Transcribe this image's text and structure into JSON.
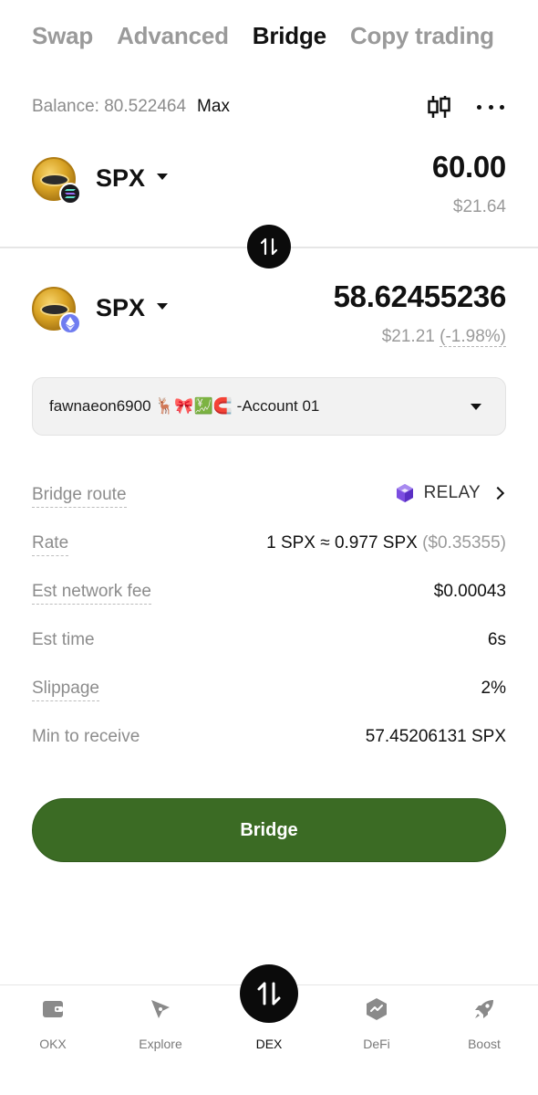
{
  "tabs": [
    {
      "label": "Swap",
      "active": false
    },
    {
      "label": "Advanced",
      "active": false
    },
    {
      "label": "Bridge",
      "active": true
    },
    {
      "label": "Copy trading",
      "active": false
    }
  ],
  "balance": {
    "label": "Balance: 80.522464",
    "max_label": "Max"
  },
  "from": {
    "symbol": "SPX",
    "chain_icon": "solana-icon",
    "amount": "60.00",
    "fiat": "$21.64"
  },
  "to": {
    "symbol": "SPX",
    "chain_icon": "ethereum-icon",
    "amount": "58.62455236",
    "fiat": "$21.21",
    "change": "(-1.98%)"
  },
  "account": {
    "label": "fawnaeon6900 🦌🎀💹🧲 -Account 01"
  },
  "details": {
    "bridge_route": {
      "label": "Bridge route",
      "value": "RELAY"
    },
    "rate": {
      "label": "Rate",
      "value": "1 SPX ≈ 0.977 SPX",
      "fiat": "($0.35355)"
    },
    "network_fee": {
      "label": "Est network fee",
      "value": "$0.00043"
    },
    "est_time": {
      "label": "Est time",
      "value": "6s"
    },
    "slippage": {
      "label": "Slippage",
      "value": "2%"
    },
    "min_receive": {
      "label": "Min to receive",
      "value": "57.45206131 SPX"
    }
  },
  "bridge_button": "Bridge",
  "nav": [
    {
      "label": "OKX",
      "icon": "wallet-icon"
    },
    {
      "label": "Explore",
      "icon": "compass-icon"
    },
    {
      "label": "DEX",
      "icon": "swap-arrows-icon",
      "active": true
    },
    {
      "label": "DeFi",
      "icon": "defi-icon"
    },
    {
      "label": "Boost",
      "icon": "rocket-icon"
    }
  ],
  "colors": {
    "accent": "#3b6b24",
    "muted": "#9a9a9a",
    "relay": "#7b4de0"
  }
}
